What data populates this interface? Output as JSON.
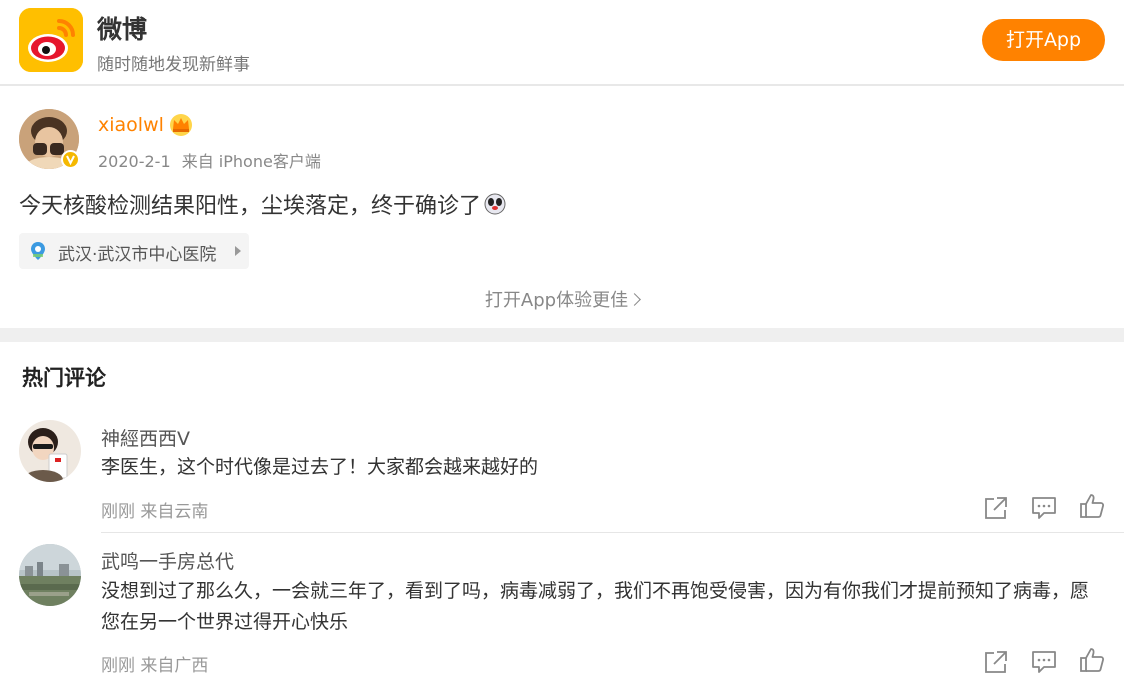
{
  "header": {
    "app_name": "微博",
    "slogan": "随时随地发现新鲜事",
    "open_app_button": "打开App",
    "logo_icon": "weibo-logo",
    "accent_color": "#ff8200"
  },
  "post": {
    "username": "xiaolwl",
    "date": "2020-2-1",
    "source": "来自 iPhone客户端",
    "text": "今天核酸检测结果阳性，尘埃落定，终于确诊了",
    "emoji": "doge-emoji",
    "location": "武汉·武汉市中心医院",
    "open_app_link": "打开App体验更佳"
  },
  "comments_section": {
    "title": "热门评论",
    "comments": [
      {
        "name": "神經西西V",
        "text": "李医生，这个时代像是过去了！大家都会越来越好的",
        "meta": "刚刚 来自云南"
      },
      {
        "name": "武鸣一手房总代",
        "text": "没想到过了那么久，一会就三年了，看到了吗，病毒减弱了，我们不再饱受侵害，因为有你我们才提前预知了病毒，愿您在另一个世界过得开心快乐",
        "meta": "刚刚 来自广西"
      }
    ]
  }
}
